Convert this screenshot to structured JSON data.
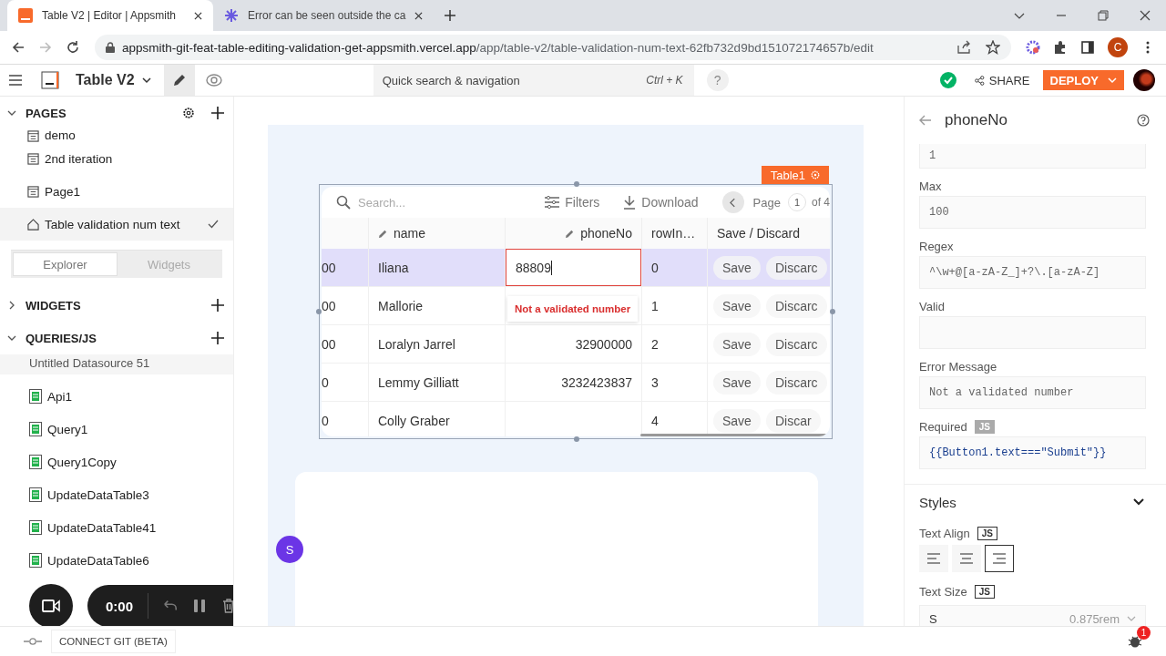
{
  "browser": {
    "tabs": [
      {
        "title": "Table V2 | Editor | Appsmith",
        "selected": true
      },
      {
        "title": "Error can be seen outside the ca",
        "selected": false
      }
    ],
    "url_host": "appsmith-git-feat-table-editing-validation-get-appsmith.vercel.app",
    "url_path": "/app/table-v2/table-validation-num-text-62fb732d9bd151072174657b/edit",
    "profile_initial": "C"
  },
  "header": {
    "app_name": "Table V2",
    "search_placeholder": "Quick search & navigation",
    "shortcut": "Ctrl + K",
    "help": "?",
    "share": "SHARE",
    "deploy": "DEPLOY"
  },
  "sidebar": {
    "pages_title": "PAGES",
    "pages": [
      {
        "name": "demo",
        "home": false,
        "selected": false
      },
      {
        "name": "2nd iteration",
        "home": false,
        "selected": false
      },
      {
        "name": "Page1",
        "home": false,
        "selected": false
      },
      {
        "name": "Table validation num text",
        "home": true,
        "selected": true
      }
    ],
    "tabs": [
      {
        "label": "Explorer",
        "selected": true
      },
      {
        "label": "Widgets",
        "selected": false
      }
    ],
    "sections": [
      {
        "title": "WIDGETS",
        "expanded": false
      },
      {
        "title": "QUERIES/JS",
        "expanded": true
      }
    ],
    "datasource": "Untitled Datasource 51",
    "queries": [
      "Api1",
      "Query1",
      "Query1Copy",
      "UpdateDataTable3",
      "UpdateDataTable41",
      "UpdateDataTable6"
    ]
  },
  "recorder": {
    "time": "0:00"
  },
  "footer": {
    "connect_git": "CONNECT GIT (BETA)"
  },
  "canvas": {
    "widget_label": "Table1",
    "avatar": "S",
    "table": {
      "search_placeholder": "Search...",
      "filters": "Filters",
      "download": "Download",
      "page_label": "Page",
      "page": "1",
      "page_of": "of 4",
      "columns": [
        {
          "label": "name",
          "editable": true
        },
        {
          "label": "phoneNo",
          "editable": true
        },
        {
          "label": "rowIn…",
          "editable": false
        },
        {
          "label": "Save / Discard",
          "editable": false
        }
      ],
      "error_tooltip": "Not a validated number",
      "rows": [
        {
          "column_1": "00",
          "name": "Iliana",
          "phoneNo": "88809",
          "row_index": "0",
          "save": "Save",
          "discard": "Discarc",
          "selected": true,
          "editing": true
        },
        {
          "column_1": "00",
          "name": "Mallorie",
          "row_index": "1",
          "save": "Save",
          "discard": "Discarc",
          "selected": false,
          "editing": false
        },
        {
          "column_1": "00",
          "name": "Loralyn Jarrel",
          "phoneNo": "32900000",
          "row_index": "2",
          "save": "Save",
          "discard": "Discarc",
          "selected": false,
          "editing": false
        },
        {
          "column_1": "0",
          "name": "Lemmy Gilliatt",
          "phoneNo": "3232423837",
          "row_index": "3",
          "save": "Save",
          "discard": "Discarc",
          "selected": false,
          "editing": false
        },
        {
          "column_1": "0",
          "name": "Colly Graber",
          "row_index": "4",
          "save": "Save",
          "discard": "Discar",
          "selected": false,
          "editing": false
        }
      ]
    }
  },
  "panel": {
    "title": "phoneNo",
    "fields": [
      {
        "value": "1",
        "kind": "text"
      },
      {
        "label": "Max",
        "value": "100",
        "kind": "text"
      },
      {
        "label": "Regex",
        "value": "^\\w+@[a-zA-Z_]+?\\.[a-zA-Z]",
        "kind": "text"
      },
      {
        "label": "Valid",
        "kind": "text"
      },
      {
        "label": "Error Message",
        "value": "Not a validated number",
        "kind": "text"
      },
      {
        "label": "Required",
        "js": true,
        "js_badge": "JS",
        "value": "{{Button1.text===\"Submit\"}}",
        "kind": "code"
      }
    ],
    "styles": {
      "title": "Styles",
      "expanded": true,
      "text_align": {
        "label": "Text Align",
        "js": false,
        "js_badge": "JS",
        "options": [
          {
            "kind": "left",
            "selected": false
          },
          {
            "kind": "center",
            "selected": false
          },
          {
            "kind": "right",
            "selected": true
          }
        ]
      },
      "text_size": {
        "label": "Text Size",
        "js": false,
        "js_badge": "JS",
        "value": "S",
        "hint": "0.875rem"
      }
    },
    "debug_count": "1"
  }
}
